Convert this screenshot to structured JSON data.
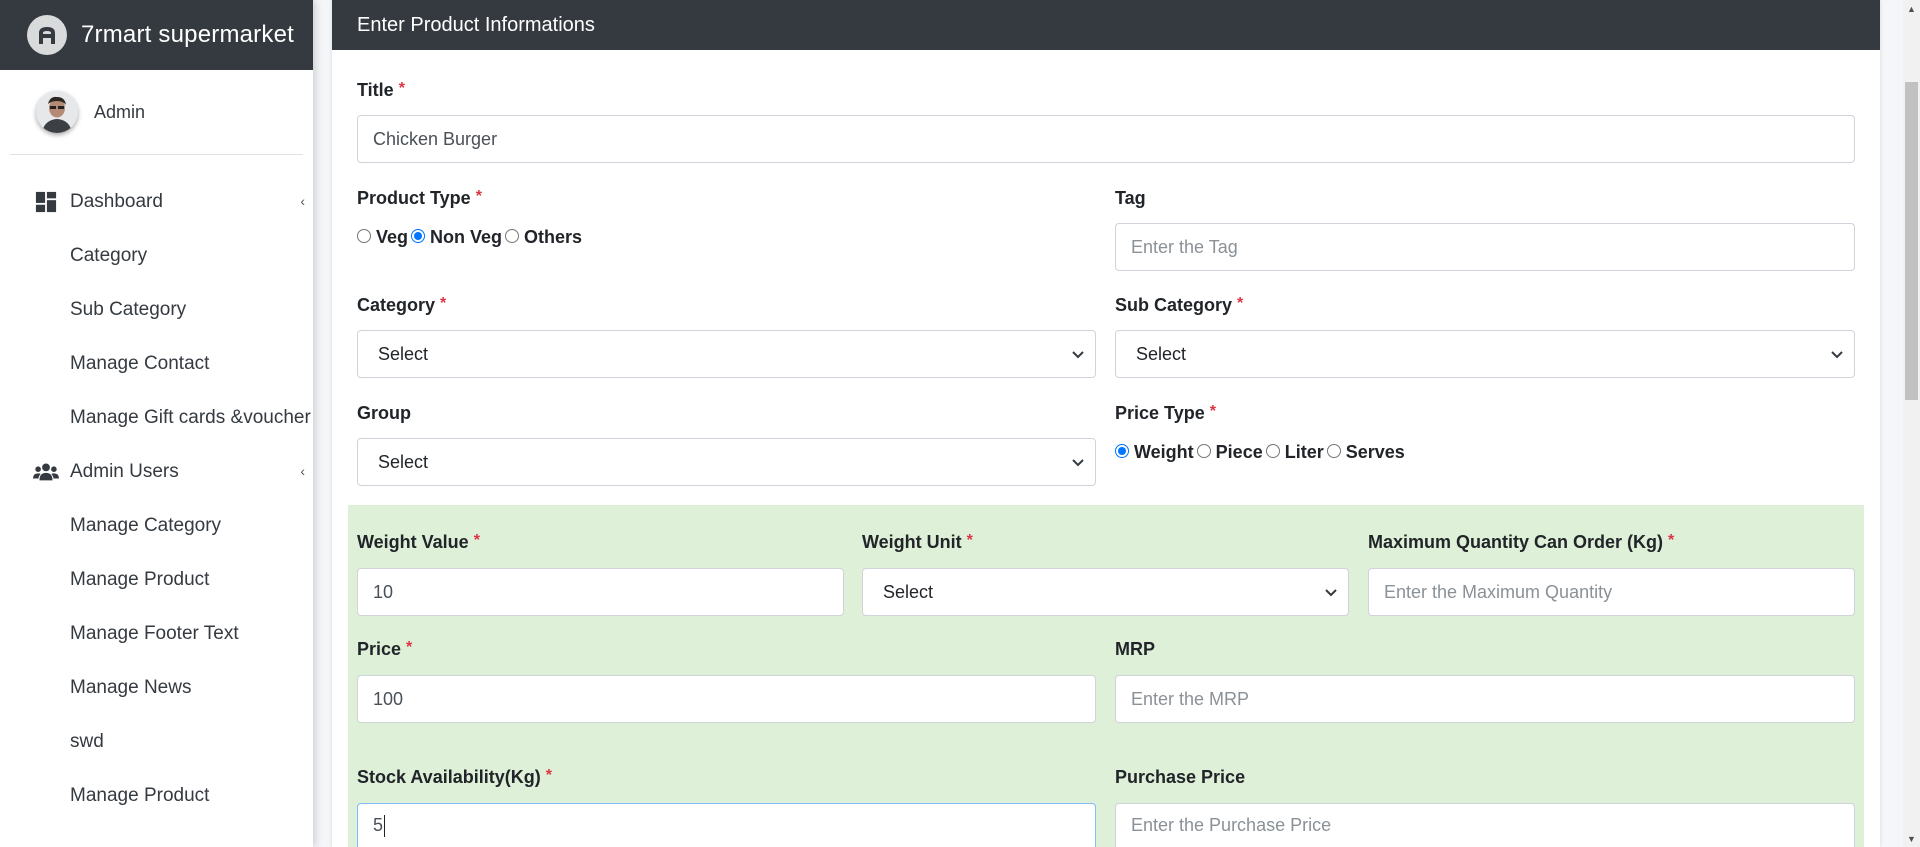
{
  "brand": {
    "name": "7rmart supermarket"
  },
  "user": {
    "name": "Admin"
  },
  "sidebar": {
    "items": [
      {
        "label": "Dashboard",
        "icon": "dashboard-icon",
        "type": "top",
        "caret": "‹"
      },
      {
        "label": "Category",
        "type": "sub"
      },
      {
        "label": "Sub Category",
        "type": "sub"
      },
      {
        "label": "Manage Contact",
        "type": "sub"
      },
      {
        "label": "Manage Gift cards &voucher",
        "type": "sub"
      },
      {
        "label": "Admin Users",
        "icon": "users-icon",
        "type": "top",
        "caret": "‹"
      },
      {
        "label": "Manage Category",
        "type": "sub"
      },
      {
        "label": "Manage Product",
        "type": "sub"
      },
      {
        "label": "Manage Footer Text",
        "type": "sub"
      },
      {
        "label": "Manage News",
        "type": "sub"
      },
      {
        "label": "swd",
        "type": "sub"
      },
      {
        "label": "Manage Product",
        "type": "sub"
      }
    ]
  },
  "form": {
    "header": "Enter Product Informations",
    "required_mark": "*",
    "title": {
      "label": "Title",
      "value": "Chicken Burger"
    },
    "product_type": {
      "label": "Product Type",
      "options": [
        "Veg",
        "Non Veg",
        "Others"
      ],
      "selected": "Non Veg"
    },
    "tag": {
      "label": "Tag",
      "placeholder": "Enter the Tag"
    },
    "category": {
      "label": "Category",
      "value": "Select"
    },
    "sub_category": {
      "label": "Sub Category",
      "value": "Select"
    },
    "group": {
      "label": "Group",
      "value": "Select"
    },
    "price_type": {
      "label": "Price Type",
      "options": [
        "Weight",
        "Piece",
        "Liter",
        "Serves"
      ],
      "selected": "Weight"
    },
    "weight_value": {
      "label": "Weight Value",
      "value": "10"
    },
    "weight_unit": {
      "label": "Weight Unit",
      "value": "Select"
    },
    "max_qty": {
      "label": "Maximum Quantity Can Order (Kg)",
      "placeholder": "Enter the Maximum Quantity"
    },
    "price": {
      "label": "Price",
      "value": "100"
    },
    "mrp": {
      "label": "MRP",
      "placeholder": "Enter the MRP"
    },
    "stock": {
      "label": "Stock Availability(Kg)",
      "value": "5"
    },
    "purchase_price": {
      "label": "Purchase Price",
      "placeholder": "Enter the Purchase Price"
    }
  },
  "colors": {
    "header_bg": "#343a40",
    "required": "#dc3545",
    "price_section_bg": "#dff0d8",
    "radio_accent": "#0075ff"
  }
}
